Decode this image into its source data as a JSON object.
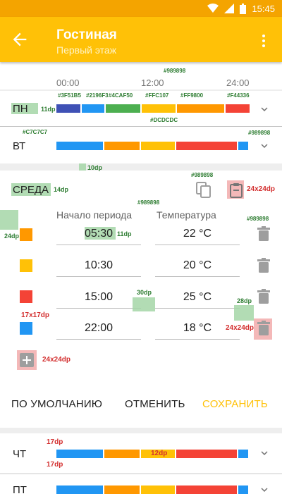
{
  "status": {
    "time": "15:45"
  },
  "appbar": {
    "title": "Гостиная",
    "subtitle": "Первый этаж"
  },
  "timeline": {
    "ticks": [
      "00:00",
      "12:00",
      "24:00"
    ]
  },
  "days": {
    "mon": {
      "label": "ПН"
    },
    "tue": {
      "label": "ВТ"
    },
    "wed": {
      "label": "СРЕДА"
    },
    "thu": {
      "label": "ЧТ"
    },
    "fri": {
      "label": "ПТ"
    }
  },
  "editor": {
    "col_start": "Начало периода",
    "col_temp": "Температура",
    "rows": [
      {
        "time": "05:30",
        "temp": "22 °C",
        "color": "#FF9800"
      },
      {
        "time": "10:30",
        "temp": "20 °C",
        "color": "#FFC107"
      },
      {
        "time": "15:00",
        "temp": "25 °C",
        "color": "#F44336"
      },
      {
        "time": "22:00",
        "temp": "18 °C",
        "color": "#2196F3"
      }
    ]
  },
  "actions": {
    "default": "ПО УМОЛЧАНИЮ",
    "cancel": "ОТМЕНИТЬ",
    "save": "СОХРАНИТЬ"
  },
  "redlines": {
    "color_chips": [
      "#3F51B5",
      "#2196F3",
      "#4CAF50",
      "#FFC107",
      "#FF9800",
      "#F44336"
    ],
    "divider_color": "#C7C7C7",
    "chevron_color": "#989898",
    "guide_color": "#DCDCDC",
    "text_gray": "#989898",
    "spec_11dp": "11dp",
    "spec_10dp": "10dp",
    "spec_14dp": "14dp",
    "spec_24dp_side": "24dp",
    "spec_24x24": "24x24dp",
    "spec_17x17": "17x17dp",
    "spec_30dp": "30dp",
    "spec_28dp": "28dp",
    "spec_17dp": "17dp",
    "spec_12dp": "12dp"
  },
  "colors": {
    "accent": "#FFC107",
    "statusbar": "#F4A400",
    "save": "#FFC107"
  },
  "icons": [
    "back-arrow-icon",
    "more-vert-icon",
    "chevron-down-icon",
    "copy-icon",
    "paste-icon",
    "trash-icon",
    "add-icon",
    "wifi-icon",
    "signal-icon",
    "battery-icon"
  ]
}
